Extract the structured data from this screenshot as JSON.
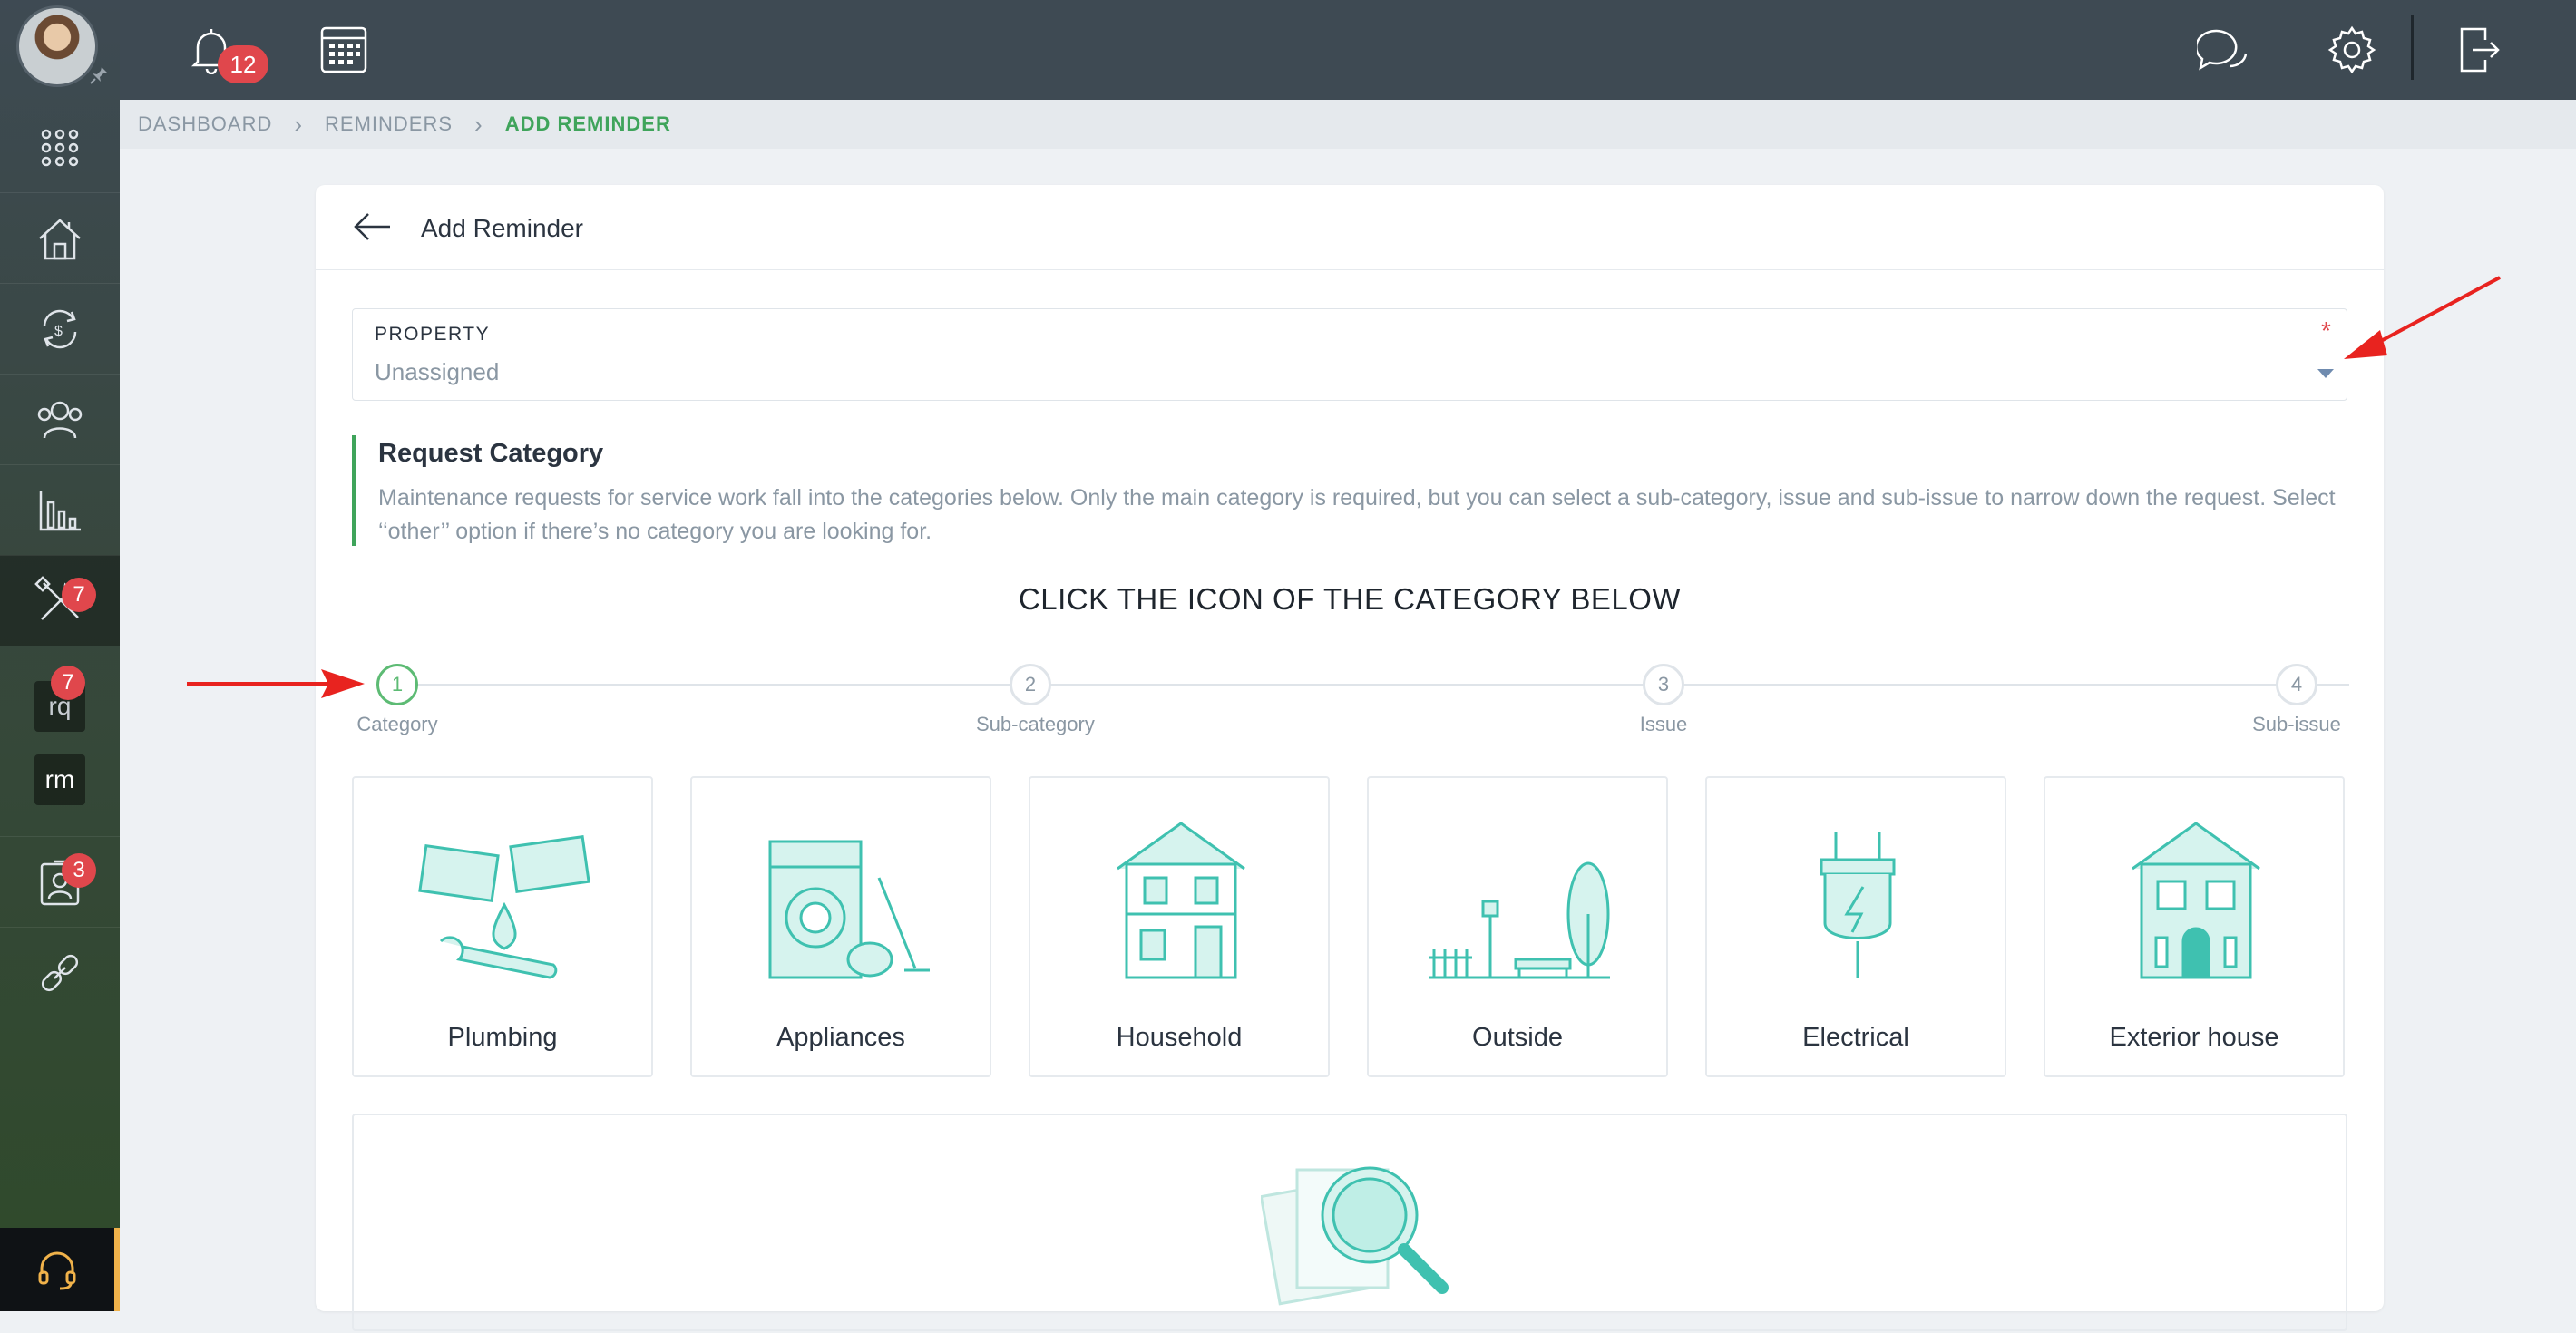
{
  "topbar": {
    "notification_count": "12",
    "icons": [
      "bell-icon",
      "calendar-icon",
      "chat-icon",
      "gear-icon",
      "logout-icon"
    ]
  },
  "sidebar": {
    "items": [
      {
        "name": "apps-grid-icon"
      },
      {
        "name": "home-icon"
      },
      {
        "name": "finance-cycle-icon"
      },
      {
        "name": "people-icon"
      },
      {
        "name": "reports-chart-icon"
      },
      {
        "name": "tools-icon",
        "badge": "7",
        "active": true
      },
      {
        "name": "rq-tile",
        "label": "rq",
        "badge": "7"
      },
      {
        "name": "rm-tile",
        "label": "rm"
      },
      {
        "name": "contact-card-icon",
        "badge": "3"
      },
      {
        "name": "link-icon"
      }
    ],
    "support_icon": "headset-icon"
  },
  "breadcrumb": {
    "items": [
      "DASHBOARD",
      "REMINDERS",
      "ADD REMINDER"
    ]
  },
  "card": {
    "title": "Add Reminder"
  },
  "property": {
    "label": "PROPERTY",
    "value": "Unassigned",
    "required_mark": "*"
  },
  "request_category": {
    "heading": "Request Category",
    "description": "Maintenance requests for service work fall into the categories below. Only the main category is required, but you can select a sub-category, issue and sub-issue to narrow down the request. Select ‘‘other’’ option if there’s no category you are looking for."
  },
  "instruction": "CLICK THE ICON OF THE CATEGORY BELOW",
  "stepper": {
    "steps": [
      {
        "number": "1",
        "label": "Category",
        "active": true
      },
      {
        "number": "2",
        "label": "Sub-category"
      },
      {
        "number": "3",
        "label": "Issue"
      },
      {
        "number": "4",
        "label": "Sub-issue"
      }
    ]
  },
  "categories": [
    {
      "label": "Plumbing"
    },
    {
      "label": "Appliances"
    },
    {
      "label": "Household"
    },
    {
      "label": "Outside"
    },
    {
      "label": "Electrical"
    },
    {
      "label": "Exterior house"
    }
  ],
  "colors": {
    "accent_green": "#3fa45b",
    "badge_red": "#e0474c",
    "icon_teal": "#3fc1b0",
    "annotation_red": "#e8231f"
  }
}
